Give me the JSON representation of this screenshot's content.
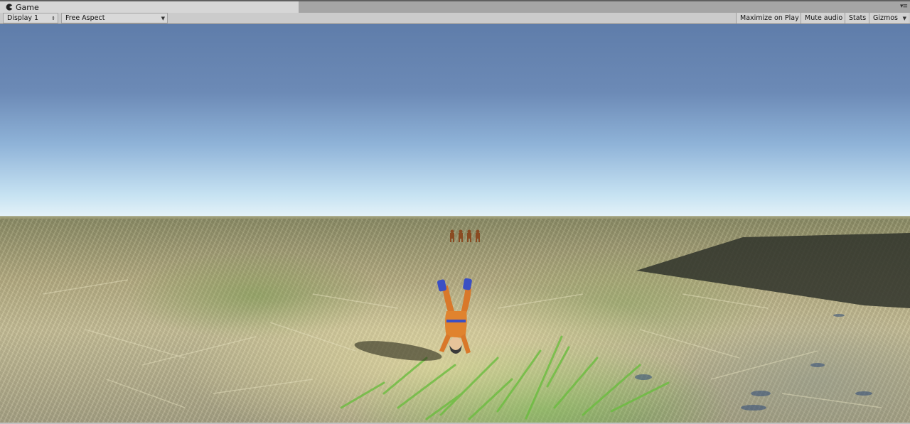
{
  "panel": {
    "tab_title": "Game",
    "tab_icon": "pacman-game-icon",
    "tab_menu_icon": "panel-menu-icon"
  },
  "toolbar": {
    "display": {
      "value": "Display 1",
      "icon": "up-down-arrow-icon"
    },
    "aspect": {
      "value": "Free Aspect",
      "icon": "dropdown-arrow-icon"
    },
    "maximize_on_play": "Maximize on Play",
    "mute_audio": "Mute audio",
    "stats": "Stats",
    "gizmos": "Gizmos",
    "gizmos_icon": "dropdown-arrow-icon"
  },
  "colors": {
    "panel_bg": "#c2c2c2",
    "sky_top": "#5f7daa",
    "sky_horizon": "#e6f3f8",
    "ground": "#b7ae84",
    "character_orange": "#d9782a",
    "character_blue": "#3b4fc4"
  }
}
